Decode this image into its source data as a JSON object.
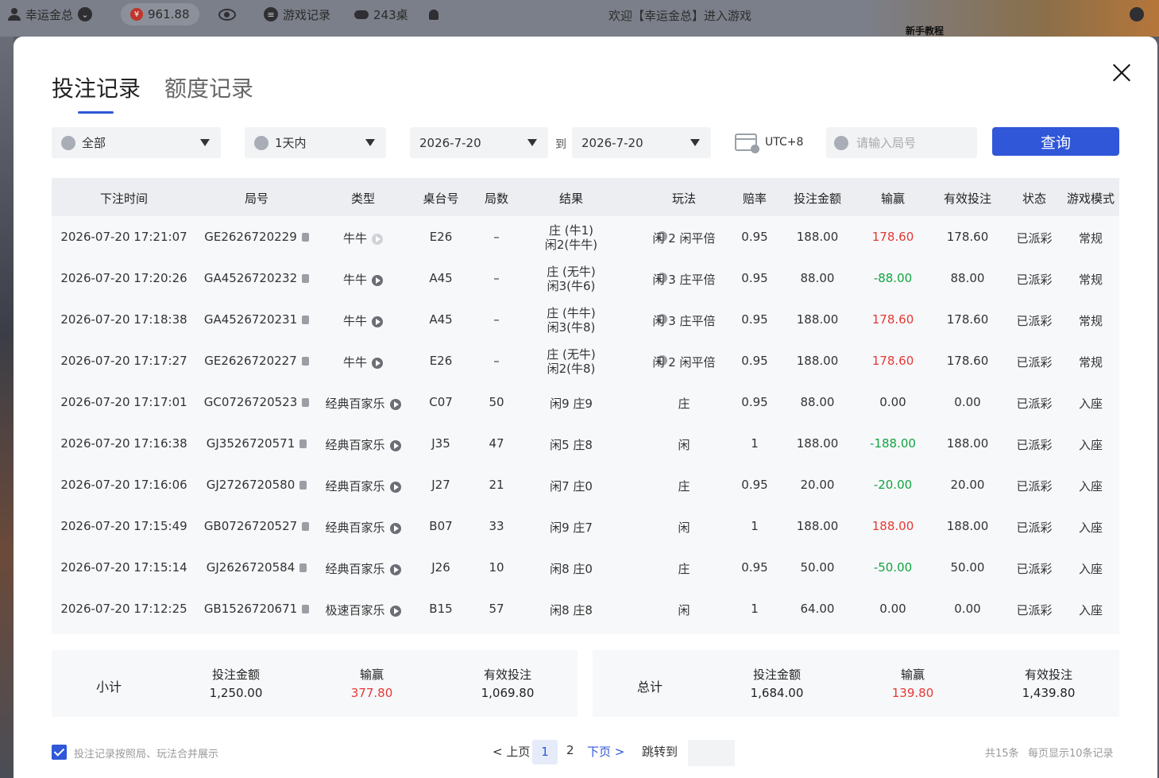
{
  "topbar": {
    "username": "幸运金总",
    "balance": "961.88",
    "game_record_label": "游戏记录",
    "tables_count": "243桌",
    "welcome_text": "欢迎【幸运金总】进入游戏",
    "promo_label": "新手教程"
  },
  "modal": {
    "tabs": [
      {
        "label": "投注记录",
        "active": true
      },
      {
        "label": "额度记录",
        "active": false
      }
    ],
    "filters": {
      "type_value": "全部",
      "range_value": "1天内",
      "date_from": "2026-7-20",
      "to_label": "到",
      "date_to": "2026-7-20",
      "timezone": "UTC+8",
      "round_placeholder": "请输入局号",
      "query_label": "查询"
    },
    "table": {
      "headers": [
        "下注时间",
        "局号",
        "类型",
        "桌台号",
        "局数",
        "结果",
        "玩法",
        "赔率",
        "投注金额",
        "输赢",
        "有效投注",
        "状态",
        "游戏模式"
      ],
      "rows": [
        {
          "time": "2026-07-20 17:21:07",
          "round": "GE2626720229",
          "type": "牛牛",
          "table": "E26",
          "count": "–",
          "result1": "庄 (牛1)",
          "result2": "闲2(牛牛)",
          "play": "闲 2 闲平倍",
          "odds": "0.95",
          "bet": "188.00",
          "win": "178.60",
          "win_color": "red",
          "valid": "178.60",
          "status": "已派彩",
          "mode": "常规",
          "play_icon_light": true
        },
        {
          "time": "2026-07-20 17:20:26",
          "round": "GA4526720232",
          "type": "牛牛",
          "table": "A45",
          "count": "–",
          "result1": "庄 (无牛)",
          "result2": "闲3(牛6)",
          "play": "闲 3 庄平倍",
          "odds": "0.95",
          "bet": "88.00",
          "win": "-88.00",
          "win_color": "green",
          "valid": "88.00",
          "status": "已派彩",
          "mode": "常规",
          "play_icon_light": false
        },
        {
          "time": "2026-07-20 17:18:38",
          "round": "GA4526720231",
          "type": "牛牛",
          "table": "A45",
          "count": "–",
          "result1": "庄 (牛牛)",
          "result2": "闲3(牛8)",
          "play": "闲 3 庄平倍",
          "odds": "0.95",
          "bet": "188.00",
          "win": "178.60",
          "win_color": "red",
          "valid": "178.60",
          "status": "已派彩",
          "mode": "常规",
          "play_icon_light": false
        },
        {
          "time": "2026-07-20 17:17:27",
          "round": "GE2626720227",
          "type": "牛牛",
          "table": "E26",
          "count": "–",
          "result1": "庄 (无牛)",
          "result2": "闲2(牛8)",
          "play": "闲 2 闲平倍",
          "odds": "0.95",
          "bet": "188.00",
          "win": "178.60",
          "win_color": "red",
          "valid": "178.60",
          "status": "已派彩",
          "mode": "常规",
          "play_icon_light": false
        },
        {
          "time": "2026-07-20 17:17:01",
          "round": "GC0726720523",
          "type": "经典百家乐",
          "table": "C07",
          "count": "50",
          "result1": "闲9 庄9",
          "result2": "",
          "play": "庄",
          "odds": "0.95",
          "bet": "88.00",
          "win": "0.00",
          "win_color": "normal",
          "valid": "0.00",
          "status": "已派彩",
          "mode": "入座",
          "play_icon_light": false
        },
        {
          "time": "2026-07-20 17:16:38",
          "round": "GJ3526720571",
          "type": "经典百家乐",
          "table": "J35",
          "count": "47",
          "result1": "闲5 庄8",
          "result2": "",
          "play": "闲",
          "odds": "1",
          "bet": "188.00",
          "win": "-188.00",
          "win_color": "green",
          "valid": "188.00",
          "status": "已派彩",
          "mode": "入座",
          "play_icon_light": false
        },
        {
          "time": "2026-07-20 17:16:06",
          "round": "GJ2726720580",
          "type": "经典百家乐",
          "table": "J27",
          "count": "21",
          "result1": "闲7 庄0",
          "result2": "",
          "play": "庄",
          "odds": "0.95",
          "bet": "20.00",
          "win": "-20.00",
          "win_color": "green",
          "valid": "20.00",
          "status": "已派彩",
          "mode": "入座",
          "play_icon_light": false
        },
        {
          "time": "2026-07-20 17:15:49",
          "round": "GB0726720527",
          "type": "经典百家乐",
          "table": "B07",
          "count": "33",
          "result1": "闲9 庄7",
          "result2": "",
          "play": "闲",
          "odds": "1",
          "bet": "188.00",
          "win": "188.00",
          "win_color": "red",
          "valid": "188.00",
          "status": "已派彩",
          "mode": "入座",
          "play_icon_light": false
        },
        {
          "time": "2026-07-20 17:15:14",
          "round": "GJ2626720584",
          "type": "经典百家乐",
          "table": "J26",
          "count": "10",
          "result1": "闲8 庄0",
          "result2": "",
          "play": "庄",
          "odds": "0.95",
          "bet": "50.00",
          "win": "-50.00",
          "win_color": "green",
          "valid": "50.00",
          "status": "已派彩",
          "mode": "入座",
          "play_icon_light": false
        },
        {
          "time": "2026-07-20 17:12:25",
          "round": "GB1526720671",
          "type": "极速百家乐",
          "table": "B15",
          "count": "57",
          "result1": "闲8 庄8",
          "result2": "",
          "play": "闲",
          "odds": "1",
          "bet": "64.00",
          "win": "0.00",
          "win_color": "normal",
          "valid": "0.00",
          "status": "已派彩",
          "mode": "入座",
          "play_icon_light": false
        }
      ]
    },
    "subtotal": {
      "label": "小计",
      "bet_label": "投注金额",
      "bet": "1,250.00",
      "win_label": "输赢",
      "win": "377.80",
      "valid_label": "有效投注",
      "valid": "1,069.80"
    },
    "total": {
      "label": "总计",
      "bet_label": "投注金额",
      "bet": "1,684.00",
      "win_label": "输赢",
      "win": "139.80",
      "valid_label": "有效投注",
      "valid": "1,439.80"
    },
    "footer": {
      "merge_label": "投注记录按照局、玩法合并展示",
      "prev_label": "< 上页",
      "pages": [
        "1",
        "2"
      ],
      "next_label": "下页 >",
      "jump_label": "跳转到",
      "total_records": "共15条",
      "per_page": "每页显示10条记录"
    }
  },
  "colors": {
    "accent": "#2f57d8",
    "win": "#e53935",
    "loss": "#11a441"
  }
}
